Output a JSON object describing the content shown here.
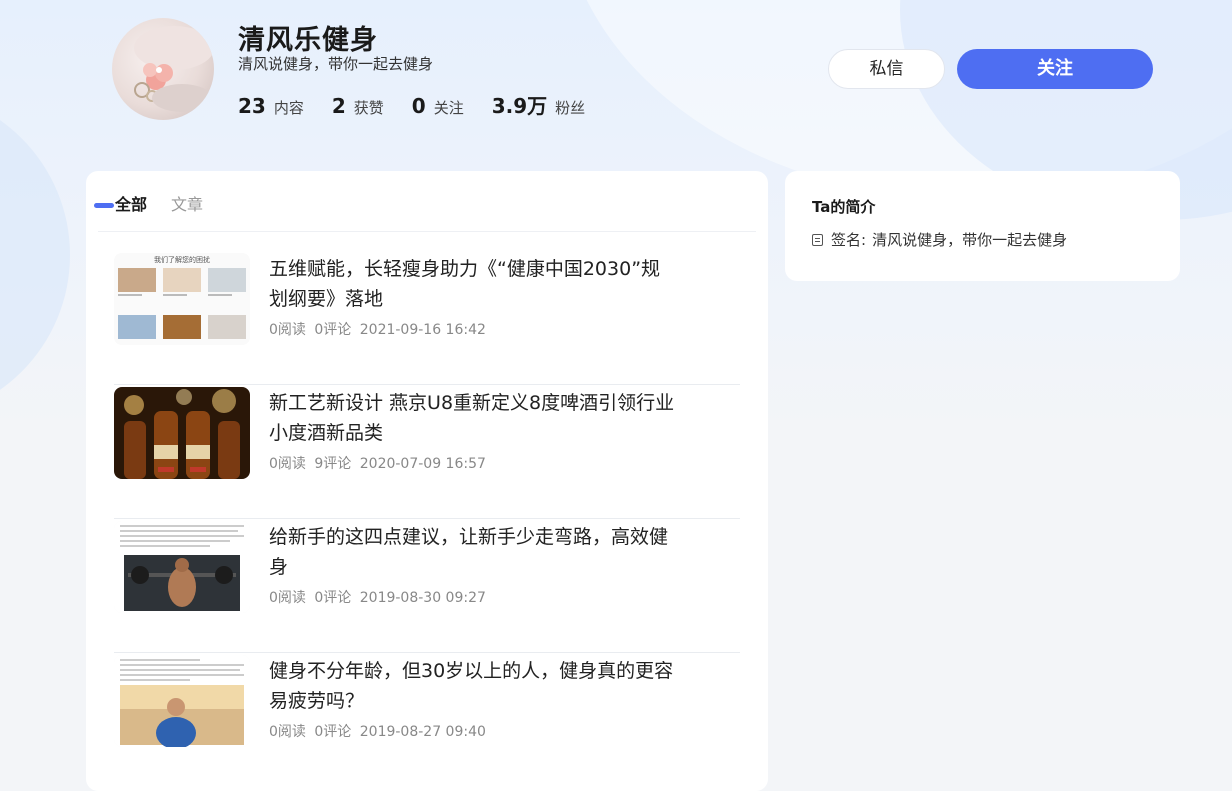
{
  "profile": {
    "name": "清风乐健身",
    "signature": "清风说健身，带你一起去健身",
    "stats": [
      {
        "num": "23",
        "label": "内容"
      },
      {
        "num": "2",
        "label": "获赞"
      },
      {
        "num": "0",
        "label": "关注"
      },
      {
        "num": "3.9万",
        "label": "粉丝"
      }
    ]
  },
  "actions": {
    "message": "私信",
    "follow": "关注"
  },
  "colors": {
    "accent": "#4e6ef2"
  },
  "tabs": [
    {
      "label": "全部",
      "active": true
    },
    {
      "label": "文章",
      "active": false
    }
  ],
  "articles": [
    {
      "title": "五维赋能，长轻瘦身助力《“健康中国2030”规划纲要》落地",
      "reads": "0阅读",
      "comments": "0评论",
      "date": "2021-09-16 16:42",
      "thumb_caption": "我们了解您的困扰"
    },
    {
      "title": "新工艺新设计 燕京U8重新定义8度啤酒引领行业小度酒新品类",
      "reads": "0阅读",
      "comments": "9评论",
      "date": "2020-07-09 16:57"
    },
    {
      "title": "给新手的这四点建议，让新手少走弯路，高效健身",
      "reads": "0阅读",
      "comments": "0评论",
      "date": "2019-08-30 09:27"
    },
    {
      "title": "健身不分年龄，但30岁以上的人，健身真的更容易疲劳吗？",
      "reads": "0阅读",
      "comments": "0评论",
      "date": "2019-08-27 09:40"
    }
  ],
  "intro": {
    "title": "Ta的简介",
    "signature_label": "签名:",
    "signature_value": "清风说健身，带你一起去健身",
    "icon": "document-icon"
  }
}
